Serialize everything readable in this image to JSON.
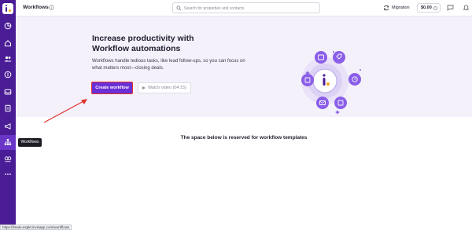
{
  "topbar": {
    "title": "Workflows",
    "search_placeholder": "Search for properties and contacts",
    "migration_label": "Migration",
    "balance": "$0.00",
    "avatar_initial": "I"
  },
  "sidebar": {
    "tooltip": "Workflows",
    "items": [
      "analytics",
      "home",
      "contacts",
      "billing",
      "inbox",
      "documents",
      "campaigns",
      "workflows",
      "integrations",
      "more"
    ]
  },
  "hero": {
    "title": "Increase productivity with Workflow automations",
    "description": "Workflows handle tedious tasks, like lead follow-ups, so you can focus on what matters most—closing deals.",
    "create_button": "Create workflow",
    "video_button": "Watch video (04:15)"
  },
  "templates": {
    "heading": "The space below is reserved for workflow templates"
  },
  "status_url": "https://lmato-espkt.invisapp.com/workflows",
  "colors": {
    "sidebar": "#4a1d96",
    "accent": "#6b2fd6",
    "hero_bg": "#f4f1fb",
    "arrow": "#e0302a"
  }
}
